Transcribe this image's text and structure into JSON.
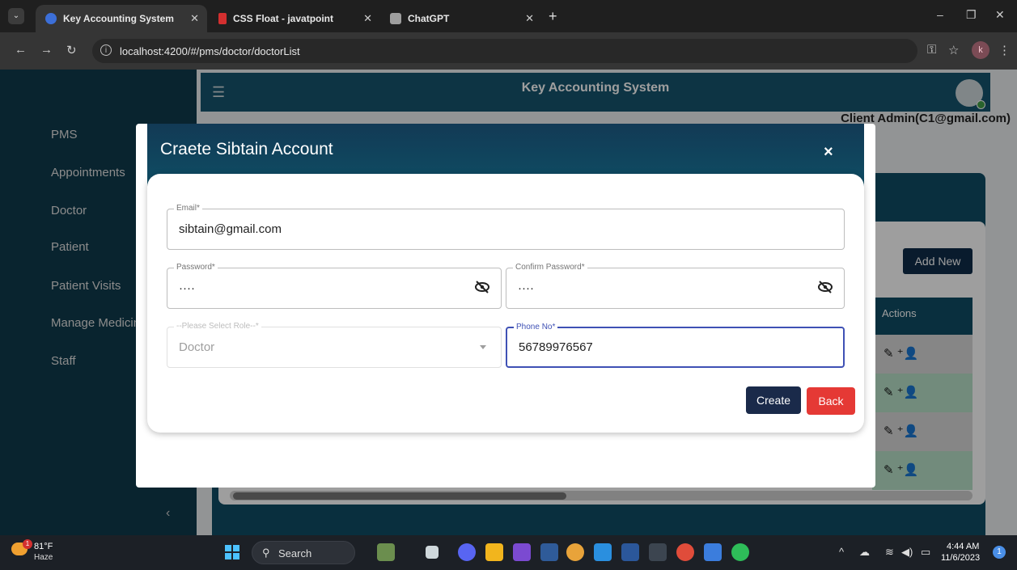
{
  "browser": {
    "tabs": [
      {
        "title": "Key Accounting System",
        "active": true,
        "favicon_color": "#3c6fd8"
      },
      {
        "title": "CSS Float - javatpoint",
        "active": false,
        "favicon_color": "#d32f2f"
      },
      {
        "title": "ChatGPT",
        "active": false,
        "favicon_color": "#9e9e9e"
      }
    ],
    "url": "localhost:4200/#/pms/doctor/doctorList",
    "profile_initial": "k"
  },
  "app": {
    "title": "Key Accounting System",
    "user": "Client Admin(C1@gmail.com)",
    "sidebar": [
      {
        "label": "PMS"
      },
      {
        "label": "Appointments"
      },
      {
        "label": "Doctor"
      },
      {
        "label": "Patient"
      },
      {
        "label": "Patient Visits"
      },
      {
        "label": "Manage Medicine"
      },
      {
        "label": "Staff"
      }
    ],
    "add_new_label": "Add New",
    "actions_header": "Actions",
    "row_colors": [
      "#d9d9d9",
      "#b8e0c8",
      "#d9d9d9",
      "#b8e0c8"
    ]
  },
  "modal": {
    "title": "Craete Sibtain Account",
    "close_icon": "×",
    "email": {
      "label": "Email*",
      "value": "sibtain@gmail.com"
    },
    "password": {
      "label": "Password*",
      "value": "····"
    },
    "confirm_password": {
      "label": "Confirm Password*",
      "value": "····"
    },
    "role": {
      "label": "--Please Select Role--*",
      "value": "Doctor"
    },
    "phone": {
      "label": "Phone No*",
      "value": "56789976567"
    },
    "create_label": "Create",
    "back_label": "Back"
  },
  "taskbar": {
    "weather_temp": "81°F",
    "weather_condition": "Haze",
    "weather_badge": "1",
    "search_label": "Search",
    "time": "4:44 AM",
    "date": "11/6/2023",
    "notification_count": "1"
  }
}
